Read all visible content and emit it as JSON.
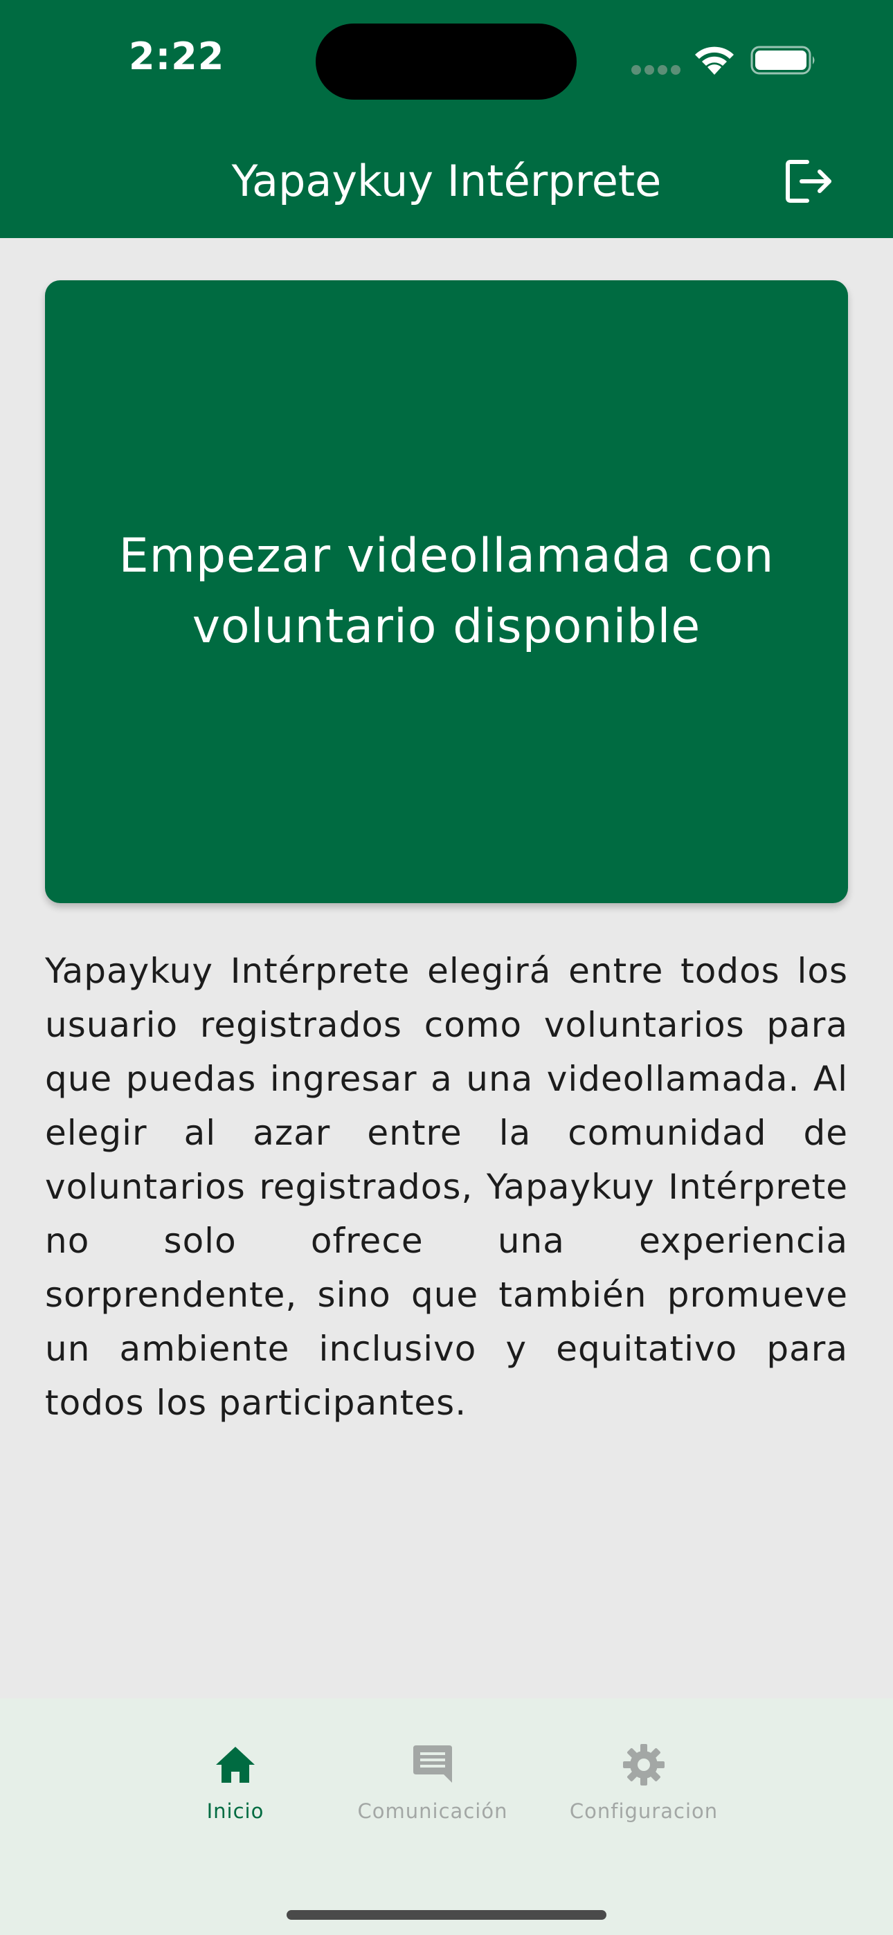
{
  "status_bar": {
    "time": "2:22"
  },
  "header": {
    "title": "Yapaykuy Intérprete",
    "logout_icon": "logout-icon"
  },
  "main": {
    "call_button_label": "Empezar videollamada con voluntario disponible",
    "description": "Yapaykuy Intérprete elegirá entre todos los usuario registrados como voluntarios para que puedas ingresar a una videollamada. Al elegir al azar entre la comunidad de voluntarios registrados, Yapaykuy Intérprete no solo ofrece una experiencia sorprendente, sino que también promueve un ambiente inclusivo y equitativo para todos los participantes."
  },
  "bottom_nav": {
    "items": [
      {
        "label": "Inicio",
        "icon": "home-icon",
        "active": true
      },
      {
        "label": "Comunicación",
        "icon": "chat-icon",
        "active": false
      },
      {
        "label": "Configuracion",
        "icon": "gear-icon",
        "active": false
      }
    ]
  },
  "colors": {
    "primary": "#006b41",
    "background": "#e9e9e9",
    "nav_background": "#e6efe8",
    "inactive": "#a3a7a5"
  }
}
